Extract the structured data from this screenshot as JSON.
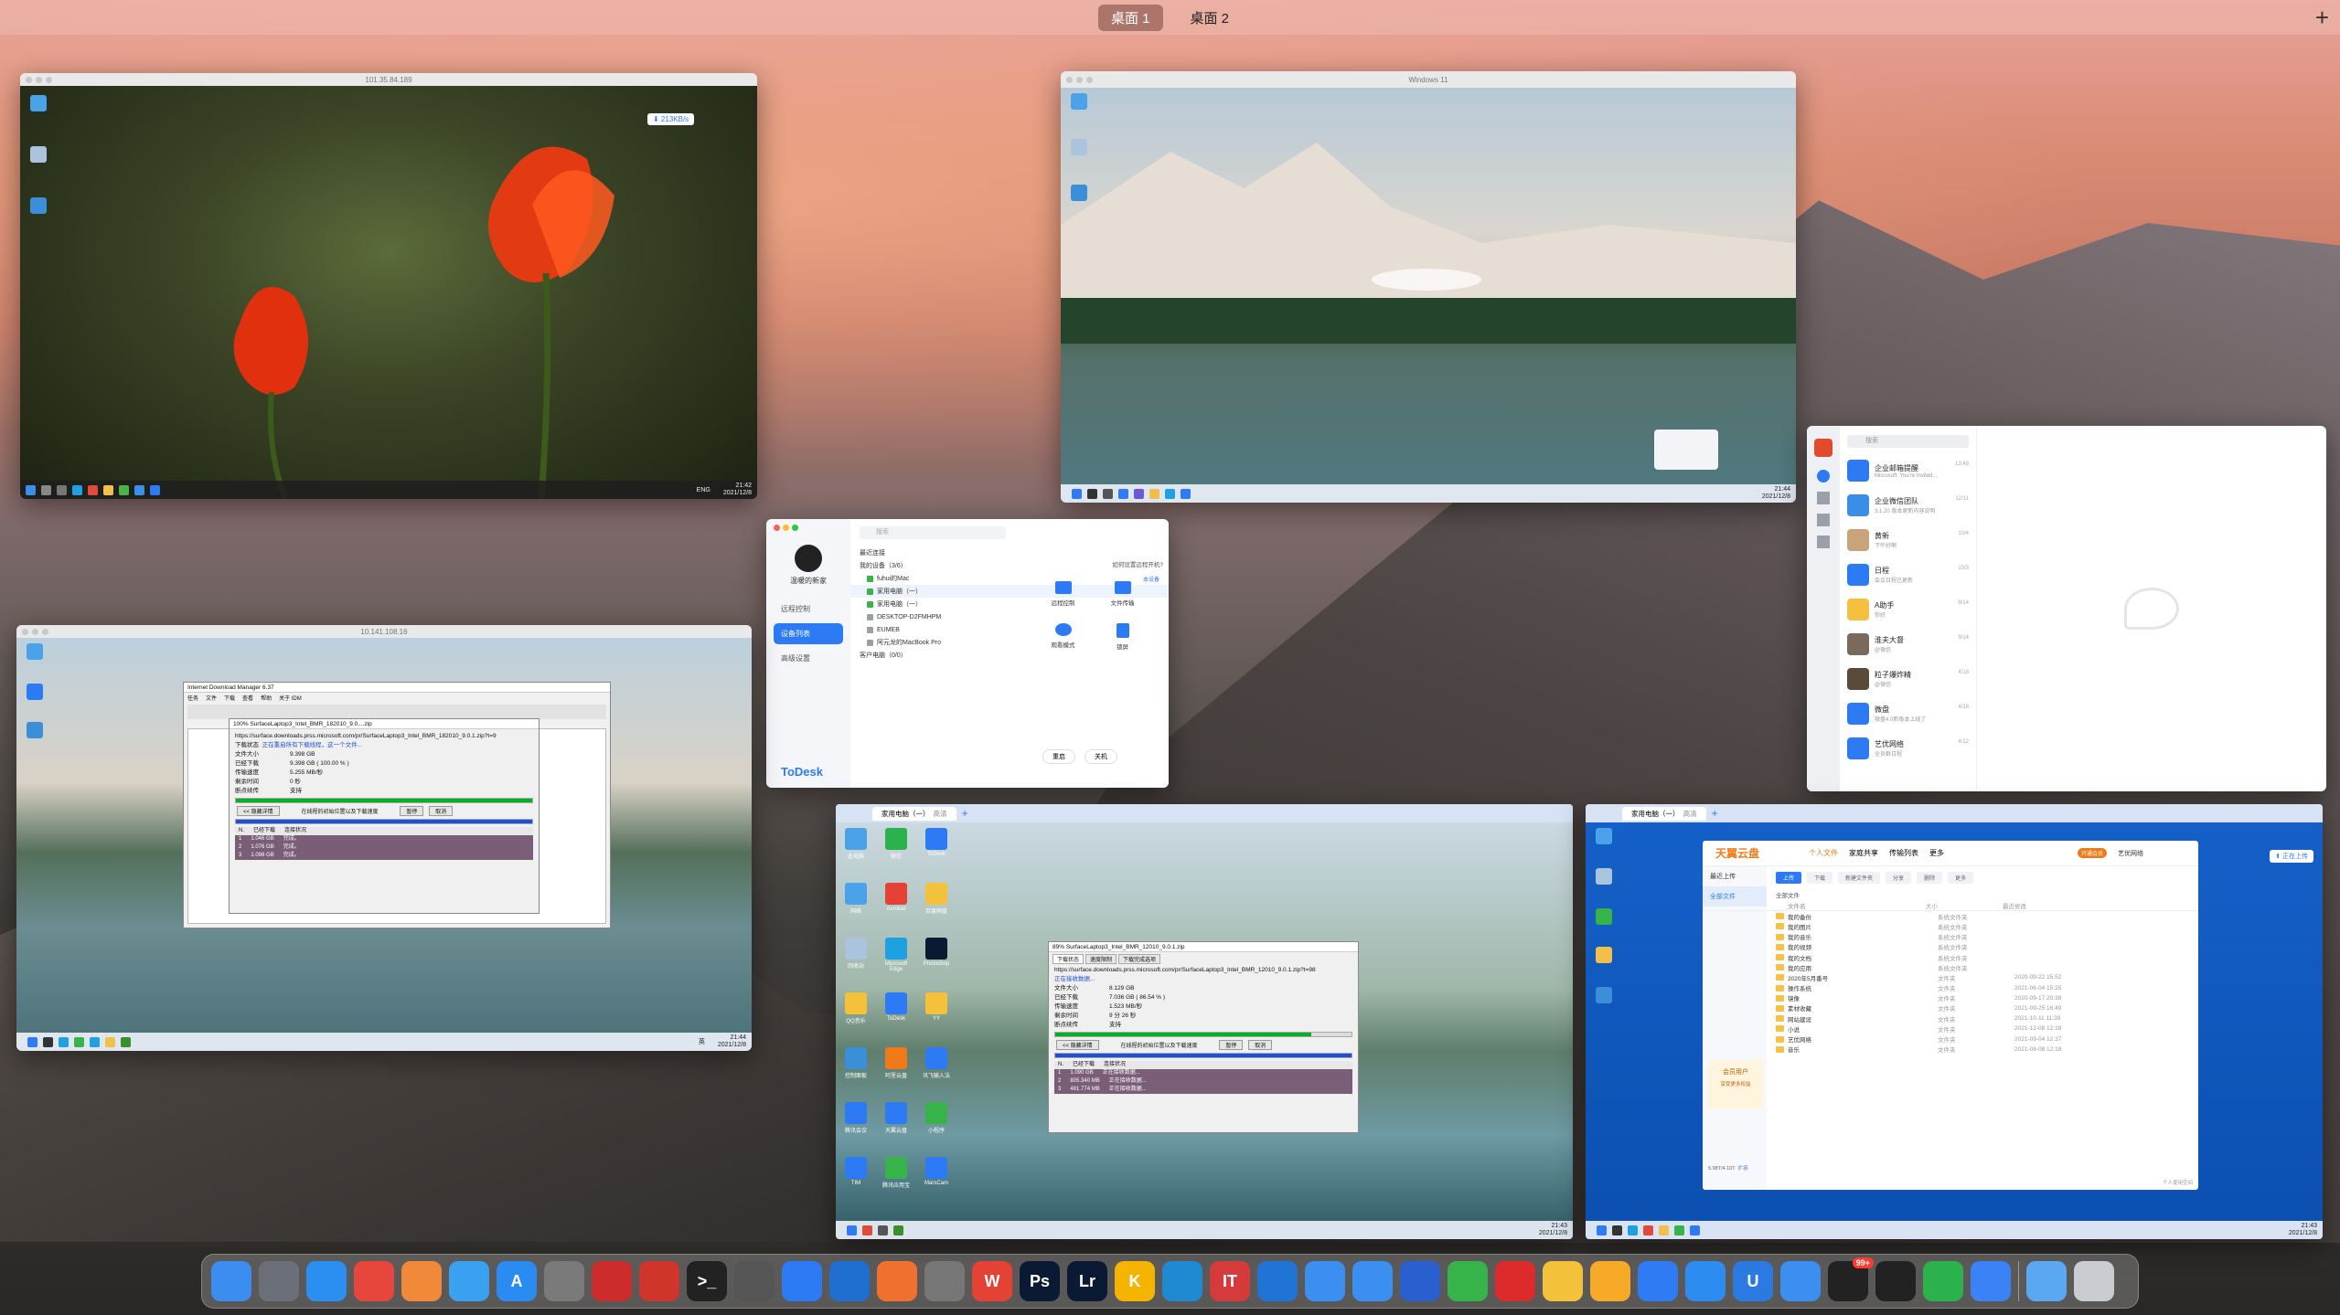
{
  "desktops": {
    "tab1": "桌面 1",
    "tab2": "桌面 2",
    "add": "+"
  },
  "win_rdp1": {
    "title": "101.35.84.189",
    "cloud_badge": "⬇ 213KB/s",
    "clock_time": "21:42",
    "clock_date": "2021/12/8",
    "lang": "ENG"
  },
  "win_vm11": {
    "title": "Windows 11",
    "clock_time": "21:44",
    "clock_date": "2021/12/8"
  },
  "win_rdp2": {
    "title": "10.141.108.16",
    "clock_time": "21:44",
    "clock_date": "2021/12/8",
    "lang": "英",
    "idm_main_title": "Internet Download Manager 6.37",
    "idm_menu": [
      "任务",
      "文件",
      "下载",
      "查看",
      "帮助",
      "关于 IDM"
    ],
    "idm_dialog_title": "100% SurfaceLaptop3_Intel_BMR_182010_9.0....zip",
    "idm_url": "https://surface.downloads.prss.microsoft.com/pr/SurfaceLaptop3_Intel_BMR_182010_9.0.1.zip?t=9",
    "idm_status_label": "下载状态",
    "idm_status_value": "正在重启所有下载线程，这一个文件...",
    "idm_fields": [
      {
        "k": "文件大小",
        "v": "9.398  GB"
      },
      {
        "k": "已经下载",
        "v": "9.398  GB ( 100.00 % )"
      },
      {
        "k": "传输速度",
        "v": "5.255  MB/秒"
      },
      {
        "k": "剩余时间",
        "v": "0 秒"
      },
      {
        "k": "断点续传",
        "v": "支持"
      }
    ],
    "idm_less": "<< 隐藏详情",
    "idm_speed_limit": "在线程的初始位置以及下载速度",
    "idm_pause": "暂停",
    "idm_cancel": "取消",
    "idm_conn_header": [
      "N.",
      "已经下载",
      "连接状况"
    ],
    "idm_conns": [
      {
        "n": "1",
        "d": "1.046  GB",
        "s": "完成。"
      },
      {
        "n": "2",
        "d": "1.076  GB",
        "s": "完成。"
      },
      {
        "n": "3",
        "d": "1.098  GB",
        "s": "完成。"
      }
    ]
  },
  "todesk": {
    "user": "温暖的新家",
    "nav": [
      "远程控制",
      "设备列表",
      "高级设置"
    ],
    "search_placeholder": "搜索",
    "recent": "最近连接",
    "my_devices": "我的设备（3/6）",
    "devices": [
      {
        "name": "fuhui的Mac",
        "tag": "本设备"
      },
      {
        "name": "家用电脑（一）",
        "tag": ""
      },
      {
        "name": "家用电脑（一）",
        "tag": ""
      },
      {
        "name": "DESKTOP-D2FMHPM",
        "tag": ""
      },
      {
        "name": "EUMEB",
        "tag": ""
      },
      {
        "name": "阿元龙的MacBook Pro",
        "tag": ""
      }
    ],
    "clients": "客户电脑（0/0）",
    "help": "如何设置远程开机?",
    "actions": [
      "远程控制",
      "文件传输",
      "观看模式",
      "锁屏"
    ],
    "restart": "重启",
    "shutdown": "关机",
    "brand": "ToDesk"
  },
  "wxwork": {
    "search_placeholder": "搜索",
    "items": [
      {
        "name": "企业邮箱提醒",
        "sub": "Microsoft: You're Invited...",
        "time": "13:48",
        "color": "#2d7bf4"
      },
      {
        "name": "企业微信团队",
        "sub": "3.1.20 版本更新内容说明",
        "time": "12/11",
        "color": "#3a8ee6"
      },
      {
        "name": "黄新",
        "sub": "下午好啊",
        "time": "10/4",
        "color": "#c9a37a"
      },
      {
        "name": "日程",
        "sub": "会议日程已更新",
        "time": "10/3",
        "color": "#2d7bf4"
      },
      {
        "name": "A助手",
        "sub": "你好",
        "time": "9/14",
        "color": "#f3c040"
      },
      {
        "name": "淮夫大督",
        "sub": "@微信",
        "time": "9/14",
        "color": "#7a6a5a"
      },
      {
        "name": "粒子爆炸精",
        "sub": "@微信",
        "time": "4/18",
        "color": "#5a4a3a"
      },
      {
        "name": "微盘",
        "sub": "微盘4.0新版本上线了",
        "time": "4/18",
        "color": "#2d7bf4"
      },
      {
        "name": "艺优网络",
        "sub": "全员群日程",
        "time": "4/12",
        "color": "#2d7bf4"
      }
    ]
  },
  "win_todesk1": {
    "tab_label": "家用电脑（一）",
    "tab_quality": "高清",
    "desktop_icons": [
      "此电脑",
      "微信",
      "ToDesk",
      "网络",
      "Acrobat",
      "百度网盘",
      "回收站",
      "Microsoft Edge",
      "Photoshop",
      "QQ音乐",
      "ToDesk",
      "YY",
      "控制面板",
      "阿里云盘",
      "讯飞输入法",
      "腾讯会议",
      "天翼云盘",
      "小程序",
      "TIM",
      "腾讯应用宝",
      "MarsCam"
    ],
    "idm_title": "89% SurfaceLaptop3_Intel_BMR_12010_9.0.1.zip",
    "idm_tabs": [
      "下载状态",
      "速度限制",
      "下载完成选项"
    ],
    "idm_url": "https://surface.downloads.prss.microsoft.com/pr/SurfaceLaptop3_Intel_BMR_12010_9.0.1.zip?t=98",
    "idm_status_value": "正在接收数据...",
    "idm_fields": [
      {
        "k": "文件大小",
        "v": "8.129  GB"
      },
      {
        "k": "已经下载",
        "v": "7.036  GB ( 86.54 % )"
      },
      {
        "k": "传输速度",
        "v": "1.523  MB/秒"
      },
      {
        "k": "剩余时间",
        "v": "9 分 26 秒"
      },
      {
        "k": "断点续传",
        "v": "支持"
      }
    ],
    "idm_less": "<< 隐藏详情",
    "idm_speed_limit": "在线程的初始位置以及下载速度",
    "idm_pause": "暂停",
    "idm_cancel": "取消",
    "idm_conn_header": [
      "N.",
      "已经下载",
      "连接状况"
    ],
    "idm_conns": [
      {
        "n": "1",
        "d": "1.090  GB",
        "s": "正在接收数据..."
      },
      {
        "n": "2",
        "d": "805.340  MB",
        "s": "正在接收数据..."
      },
      {
        "n": "3",
        "d": "481.774  MB",
        "s": "正在接收数据..."
      }
    ],
    "clock_time": "21:43",
    "clock_date": "2021/12/8"
  },
  "win_todesk2": {
    "tab_label": "家用电脑（一）",
    "tab_quality": "高清",
    "upload_badge": "⬆ 正在上传",
    "cloud": {
      "brand": "天翼云盘",
      "tabs": [
        "个人文件",
        "家庭共享",
        "传输列表",
        "更多"
      ],
      "member": "开通会员",
      "user": "艺优网络",
      "left_nav": [
        "最近上传",
        "全部文件"
      ],
      "toolbar": [
        "上传",
        "下载",
        "新建文件夹",
        "分享",
        "删除",
        "更多"
      ],
      "path": "全部文件",
      "columns": [
        "文件名",
        "大小",
        "最近修改"
      ],
      "rows": [
        {
          "name": "我的备份",
          "size": "系统文件夹",
          "date": ""
        },
        {
          "name": "我的图片",
          "size": "系统文件夹",
          "date": ""
        },
        {
          "name": "我的音乐",
          "size": "系统文件夹",
          "date": ""
        },
        {
          "name": "我的视频",
          "size": "系统文件夹",
          "date": ""
        },
        {
          "name": "我的文档",
          "size": "系统文件夹",
          "date": ""
        },
        {
          "name": "我的应用",
          "size": "系统文件夹",
          "date": ""
        },
        {
          "name": "2020年5月番号",
          "size": "文件夹",
          "date": "2020-09-22 15:52"
        },
        {
          "name": "操作系统",
          "size": "文件夹",
          "date": "2021-06-04 15:25"
        },
        {
          "name": "镜像",
          "size": "文件夹",
          "date": "2020-09-17 20:38"
        },
        {
          "name": "素材收藏",
          "size": "文件夹",
          "date": "2021-09-25 16:49"
        },
        {
          "name": "网站建设",
          "size": "文件夹",
          "date": "2021-10-11 11:39"
        },
        {
          "name": "小说",
          "size": "文件夹",
          "date": "2021-12-08 12:18"
        },
        {
          "name": "艺优网络",
          "size": "文件夹",
          "date": "2021-09-04 12:37"
        },
        {
          "name": "音乐",
          "size": "文件夹",
          "date": "2021-08-08 12:18"
        }
      ],
      "promo_title": "会员用户",
      "promo_sub": "享受更多权益",
      "quota": "5.98T/4.10T",
      "quota_link": "扩容",
      "footer": "个人使用空间"
    },
    "clock_time": "21:43",
    "clock_date": "2021/12/8"
  },
  "dock": {
    "apps": [
      {
        "name": "finder",
        "label": "",
        "color": "#3b8df0"
      },
      {
        "name": "launchpad",
        "label": "",
        "color": "#6b6f78"
      },
      {
        "name": "safari",
        "label": "",
        "color": "#2b8ff2"
      },
      {
        "name": "chrome",
        "label": "",
        "color": "#e6463b"
      },
      {
        "name": "photos",
        "label": "",
        "color": "#f08a3a"
      },
      {
        "name": "qq-browser",
        "label": "",
        "color": "#3aa0f0"
      },
      {
        "name": "app-store",
        "label": "A",
        "color": "#2a8cf2"
      },
      {
        "name": "system-prefs",
        "label": "",
        "color": "#7a7a7a"
      },
      {
        "name": "parallels",
        "label": "",
        "color": "#cc2c2c"
      },
      {
        "name": "remote-desktop",
        "label": "",
        "color": "#d0352b"
      },
      {
        "name": "terminal",
        "label": ">_",
        "color": "#222222"
      },
      {
        "name": "printer",
        "label": "",
        "color": "#555555"
      },
      {
        "name": "todesk",
        "label": "",
        "color": "#2d7bf4"
      },
      {
        "name": "microsoft-remote",
        "label": "",
        "color": "#1f6fd1"
      },
      {
        "name": "settings-gear",
        "label": "",
        "color": "#f07030"
      },
      {
        "name": "pro-app",
        "label": "",
        "color": "#777777"
      },
      {
        "name": "wps",
        "label": "W",
        "color": "#e34234"
      },
      {
        "name": "photoshop",
        "label": "Ps",
        "color": "#0b1a33"
      },
      {
        "name": "lightroom",
        "label": "Lr",
        "color": "#0b1a33"
      },
      {
        "name": "keynote-k",
        "label": "K",
        "color": "#f4b400"
      },
      {
        "name": "vscode",
        "label": "",
        "color": "#1f8ad2"
      },
      {
        "name": "intellij",
        "label": "IT",
        "color": "#d63b3b"
      },
      {
        "name": "onedrive",
        "label": "",
        "color": "#1f74d6"
      },
      {
        "name": "baidu-netdisk",
        "label": "",
        "color": "#3a8ff0"
      },
      {
        "name": "ali-cloud",
        "label": "",
        "color": "#3a8ff0"
      },
      {
        "name": "aperture",
        "label": "",
        "color": "#2a5fd0"
      },
      {
        "name": "video-player",
        "label": "",
        "color": "#36b44a"
      },
      {
        "name": "netease-music",
        "label": "",
        "color": "#dd2b2b"
      },
      {
        "name": "qq-music",
        "label": "",
        "color": "#f4c23a"
      },
      {
        "name": "scissor-app",
        "label": "",
        "color": "#f7a928"
      },
      {
        "name": "feishu",
        "label": "",
        "color": "#2f7bf4"
      },
      {
        "name": "wechat-work",
        "label": "",
        "color": "#2d8cf0"
      },
      {
        "name": "mail-u",
        "label": "U",
        "color": "#2a7ae2"
      },
      {
        "name": "tencent-meeting",
        "label": "",
        "color": "#3a8ff0"
      },
      {
        "name": "qq",
        "label": "",
        "color": "#222222"
      },
      {
        "name": "qq-2",
        "label": "",
        "color": "#222222"
      },
      {
        "name": "wechat",
        "label": "",
        "color": "#2bb24c"
      },
      {
        "name": "todo",
        "label": "",
        "color": "#3b82f6"
      }
    ],
    "qq_badge": "99+",
    "downloads": "",
    "trash": ""
  }
}
